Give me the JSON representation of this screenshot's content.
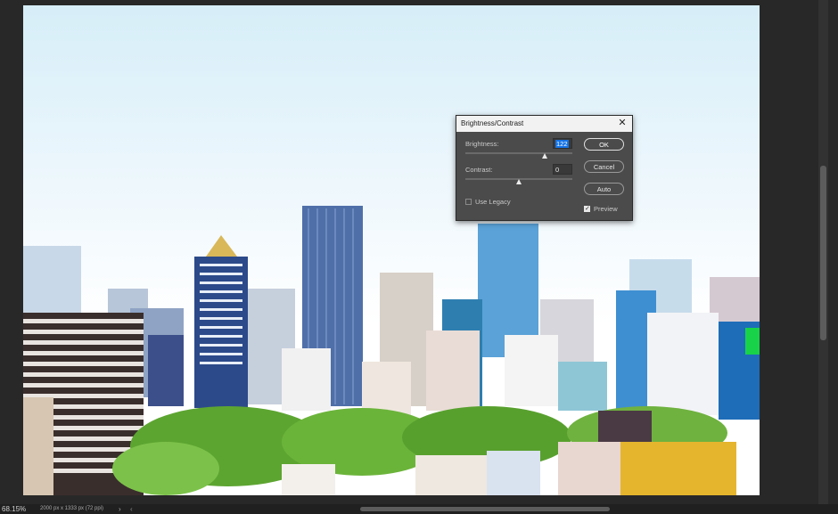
{
  "status_bar": {
    "zoom": "68.15%",
    "doc_info": "2000 px x 1333 px (72 ppi)",
    "arrow": "›",
    "scroll_left": "‹"
  },
  "dialog": {
    "title": "Brightness/Contrast",
    "close_icon": "close-icon",
    "brightness_label": "Brightness:",
    "brightness_value": "122",
    "brightness_slider_level": 0.74,
    "contrast_label": "Contrast:",
    "contrast_value": "0",
    "contrast_slider_level": 0.5,
    "use_legacy_label": "Use Legacy",
    "use_legacy_checked": false,
    "ok_label": "OK",
    "cancel_label": "Cancel",
    "auto_label": "Auto",
    "preview_label": "Preview",
    "preview_checked": true
  },
  "colors": {
    "app_background": "#282828",
    "dialog_background": "#4b4b4b",
    "selection_accent": "#1473e6"
  }
}
